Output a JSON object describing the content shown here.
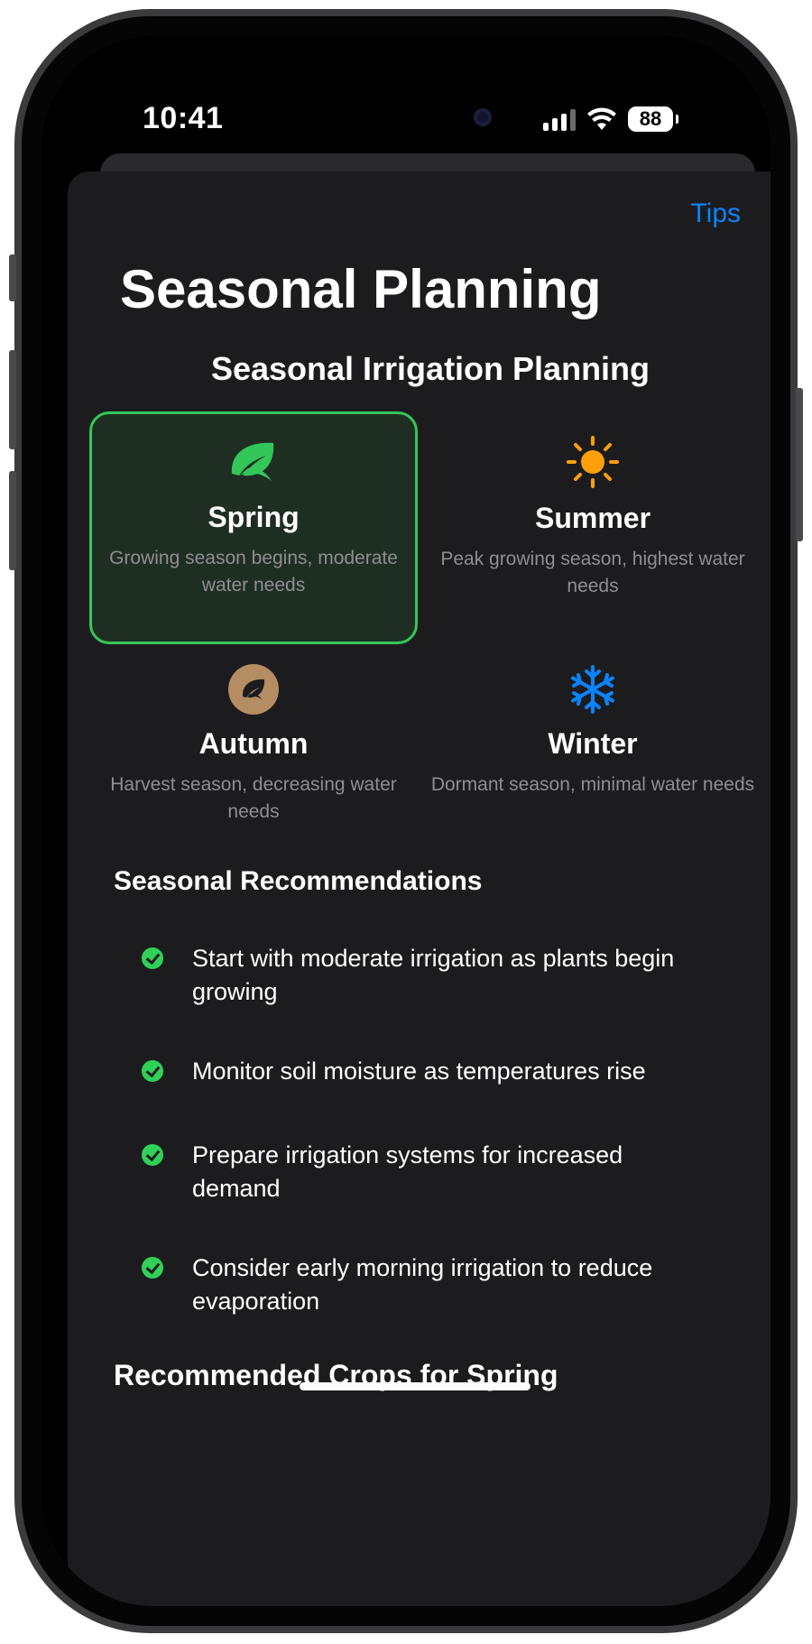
{
  "status_bar": {
    "time": "10:41",
    "battery": "88"
  },
  "header": {
    "tips_label": "Tips",
    "title": "Seasonal Planning"
  },
  "section_title": "Seasonal Irrigation Planning",
  "seasons": [
    {
      "name": "Spring",
      "description": "Growing season begins, moderate water needs",
      "icon": "leaf-icon",
      "selected": true
    },
    {
      "name": "Summer",
      "description": "Peak growing season, highest water needs",
      "icon": "sun-icon",
      "selected": false
    },
    {
      "name": "Autumn",
      "description": "Harvest season, decreasing water needs",
      "icon": "autumn-leaf-icon",
      "selected": false
    },
    {
      "name": "Winter",
      "description": "Dormant season, minimal water needs",
      "icon": "snowflake-icon",
      "selected": false
    }
  ],
  "recommendations": {
    "title": "Seasonal Recommendations",
    "items": [
      "Start with moderate irrigation as plants begin growing",
      "Monitor soil moisture as temperatures rise",
      "Prepare irrigation systems for increased demand",
      "Consider early morning irrigation to reduce evaporation"
    ]
  },
  "crops": {
    "title": "Recommended Crops for Spring"
  },
  "colors": {
    "accent_blue": "#0a84ff",
    "selected_green": "#33c759",
    "sun_orange": "#ff9f0a",
    "snow_blue": "#0a84ff",
    "autumn_tan": "#b58d63",
    "sheet_bg": "#1c1c1e"
  }
}
